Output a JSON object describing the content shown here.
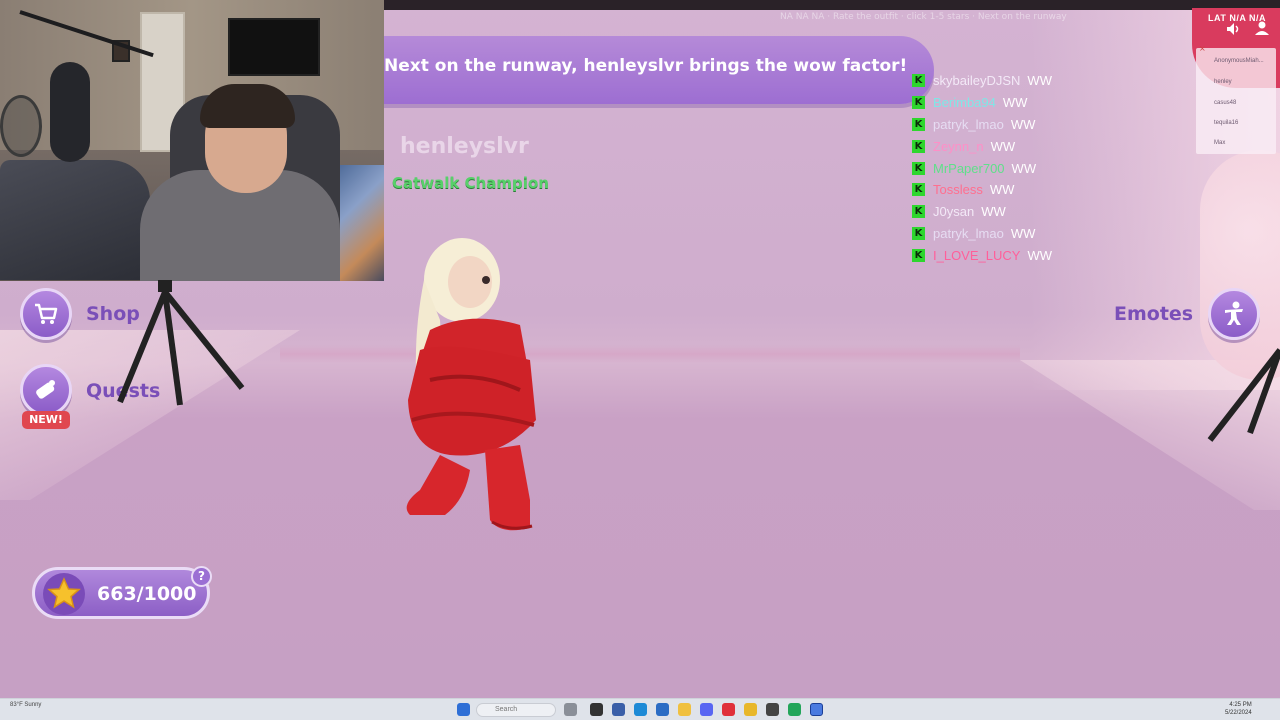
{
  "banner": {
    "text": "Next on the runway, henleyslvr brings the wow factor!"
  },
  "player": {
    "name": "henleyslvr",
    "title": "Catwalk Champion"
  },
  "overlay": {
    "faded_text": "NA NA NA · Rate the outfit · click 1-5 stars · Next on the runway"
  },
  "chat": [
    {
      "badge": "K",
      "user": "skybaileyDJSN",
      "color": "#f3e9f7",
      "message": "WW"
    },
    {
      "badge": "K",
      "user": "Berimba94",
      "color": "#7fe7e6",
      "message": "WW"
    },
    {
      "badge": "K",
      "user": "patryk_lmao",
      "color": "#e6dcf2",
      "message": "WW"
    },
    {
      "badge": "K",
      "user": "Zeynn_n",
      "color": "#ff8fc7",
      "message": "WW"
    },
    {
      "badge": "K",
      "user": "MrPaper700",
      "color": "#5fe08a",
      "message": "WW"
    },
    {
      "badge": "K",
      "user": "Tossless",
      "color": "#ff6f8f",
      "message": "WW"
    },
    {
      "badge": "K",
      "user": "J0ysan",
      "color": "#f3e9f7",
      "message": "WW"
    },
    {
      "badge": "K",
      "user": "patryk_lmao",
      "color": "#e6dcf2",
      "message": "WW"
    },
    {
      "badge": "K",
      "user": "I_LOVE_LUCY",
      "color": "#ff5f9a",
      "message": "WW"
    }
  ],
  "hud": {
    "shop_label": "Shop",
    "quests_label": "Quests",
    "new_badge": "NEW!",
    "emotes_label": "Emotes",
    "score": "663/1000",
    "help": "?"
  },
  "corner": {
    "labels": "LAT  N/A   N/A",
    "players": [
      "AnonymousMiah...",
      "henley",
      "casus48",
      "tequila16",
      "Max"
    ]
  },
  "taskbar": {
    "search_placeholder": "Search",
    "weather": "83°F  Sunny",
    "time": "4:25 PM",
    "date": "5/22/2024"
  },
  "colors": {
    "accent": "#9d6ed2",
    "label": "#7a4fb8",
    "badge_green": "#2ed62e",
    "new_red": "#e0474f"
  }
}
